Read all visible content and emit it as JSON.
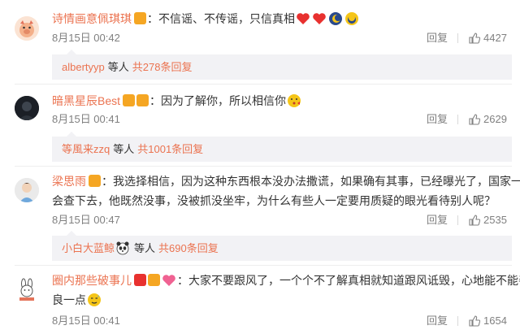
{
  "comments": [
    {
      "name": "诗情画意佩琪琪",
      "text": "：不信谣、不传谣，只信真相",
      "time": "8月15日 00:42",
      "reply_label": "回复",
      "likes": "4427",
      "sub": {
        "name": "albertyyp",
        "mid": "等人",
        "count": "共278条回复"
      }
    },
    {
      "name": "暗黑星辰Best",
      "text": "：因为了解你，所以相信你",
      "time": "8月15日 00:41",
      "reply_label": "回复",
      "likes": "2629",
      "sub": {
        "name": "等風来zzq",
        "mid": "等人",
        "count": "共1001条回复"
      }
    },
    {
      "name": "梁思雨",
      "text_line1": "：我选择相信，因为这种东西根本没办法撒谎，如果确有其事，已经曝光了，国家一定",
      "text_line2": "会查下去，他既然没事，没被抓没坐牢，为什么有些人一定要用质疑的眼光看待别人呢？",
      "time": "8月15日 00:47",
      "reply_label": "回复",
      "likes": "2535",
      "sub": {
        "name": "小白大蓝鲸",
        "mid": "等人",
        "count": "共690条回复"
      }
    },
    {
      "name": "圈内那些破事儿",
      "text_line1": "：大家不要跟风了，一个个不了解真相就知道跟风诋毁，心地能不能善",
      "text_line2": "良一点",
      "time": "8月15日 00:41",
      "reply_label": "回复",
      "likes": "1654"
    }
  ],
  "colors": {
    "name": "#eb7350",
    "text": "#333333",
    "meta": "#808080",
    "sub_bg": "#f2f2f5"
  }
}
